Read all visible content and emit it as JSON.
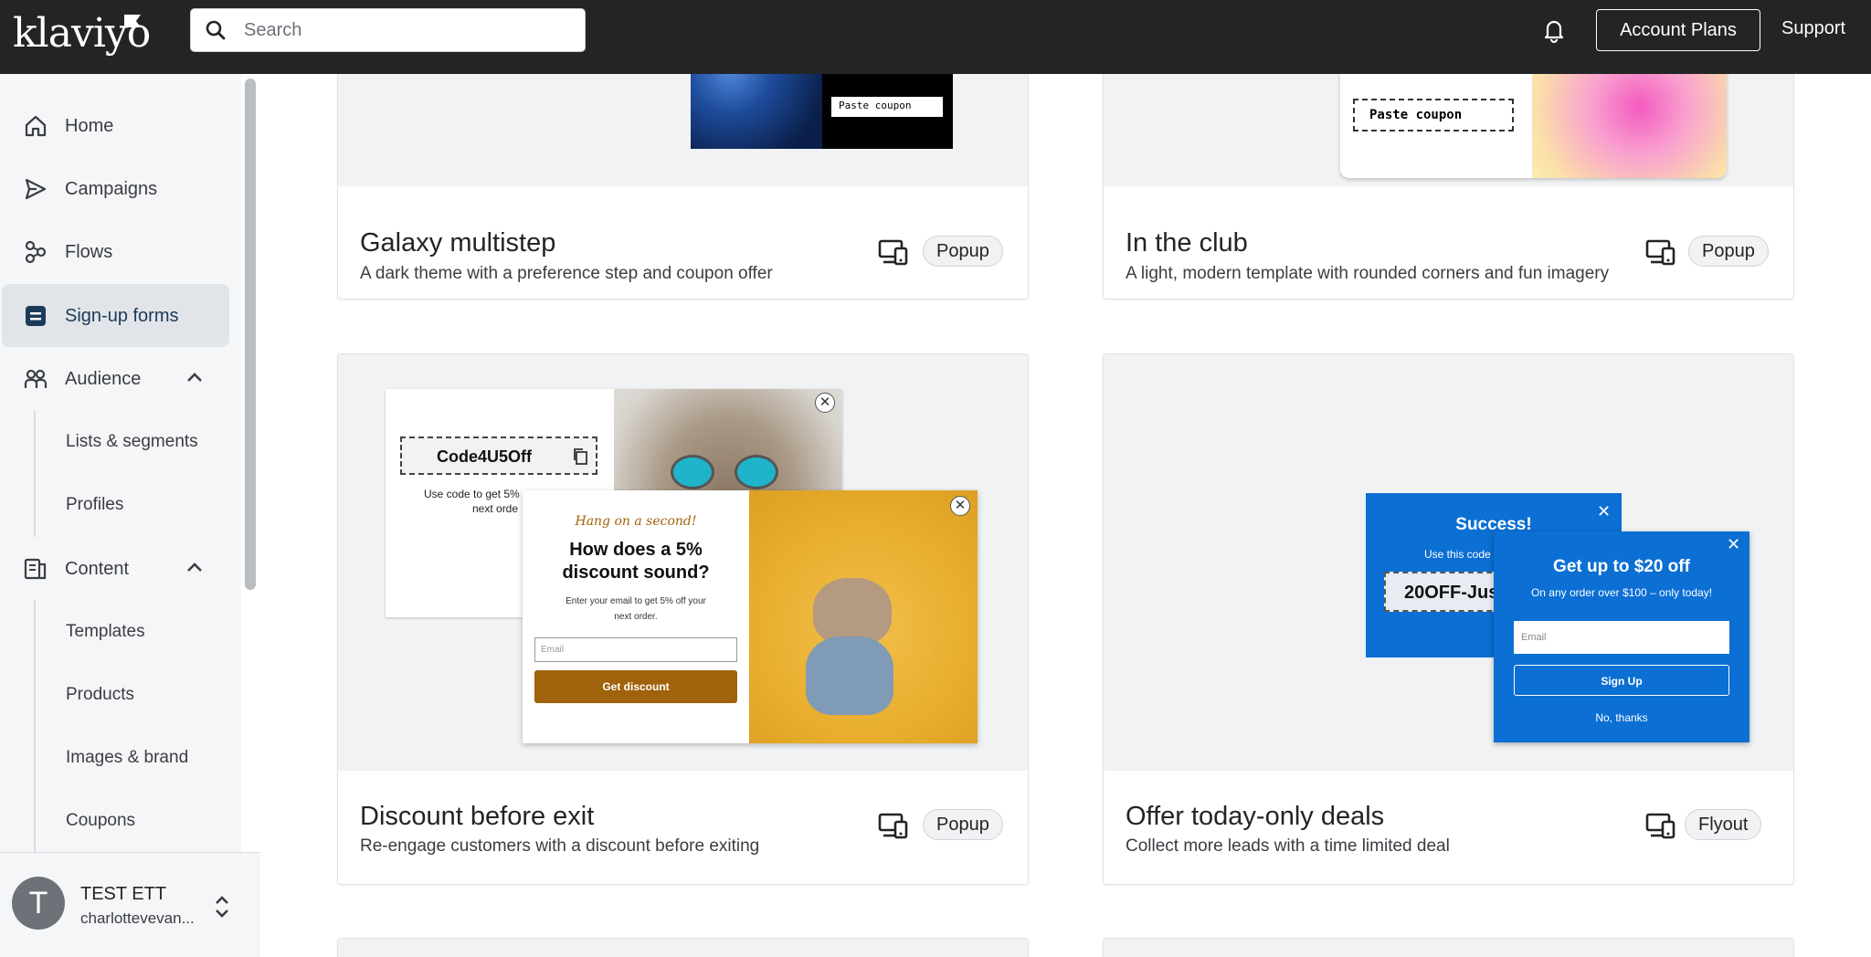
{
  "topbar": {
    "logo": "klaviyo",
    "search_placeholder": "Search",
    "account_plans_label": "Account Plans",
    "support_label": "Support"
  },
  "sidebar": {
    "items": [
      {
        "label": "Home",
        "icon": "home-icon"
      },
      {
        "label": "Campaigns",
        "icon": "send-icon"
      },
      {
        "label": "Flows",
        "icon": "flow-icon"
      },
      {
        "label": "Sign-up forms",
        "icon": "form-icon",
        "active": true
      },
      {
        "label": "Audience",
        "icon": "audience-icon",
        "expanded": true
      },
      {
        "label": "Content",
        "icon": "content-icon",
        "expanded": true
      }
    ],
    "audience_sub": [
      "Lists & segments",
      "Profiles"
    ],
    "content_sub": [
      "Templates",
      "Products",
      "Images & brand",
      "Coupons"
    ],
    "user": {
      "initial": "T",
      "name": "TEST ETT",
      "email": "charlottevevan..."
    }
  },
  "cards": [
    {
      "title": "Galaxy multistep",
      "description": "A dark theme with a preference step and coupon offer",
      "tag": "Popup",
      "preview_text": [
        "Paste coupon"
      ]
    },
    {
      "title": "In the club",
      "description": "A light, modern template with rounded corners and fun imagery",
      "tag": "Popup",
      "preview_text": [
        "Paste coupon"
      ]
    },
    {
      "title": "Discount before exit",
      "description": "Re-engage customers with a discount before exiting",
      "tag": "Popup",
      "preview": {
        "code": "Code4U5Off",
        "code_note_line1": "Use code to get 5%",
        "code_note_line2": "next orde",
        "eyebrow": "Hang on a second!",
        "headline_line1": "How does a 5%",
        "headline_line2": "discount sound?",
        "body_line1": "Enter your email to get 5% off your",
        "body_line2": "next order.",
        "email_placeholder": "Email",
        "button": "Get discount"
      }
    },
    {
      "title": "Offer today-only deals",
      "description": "Collect more leads with a time limited deal",
      "tag": "Flyout",
      "preview": {
        "success_title": "Success!",
        "success_note": "Use this code",
        "code": "20OFF-Jus",
        "headline": "Get up to $20 off",
        "subline": "On any order over $100 – only today!",
        "email_placeholder": "Email",
        "button": "Sign Up",
        "decline": "No, thanks"
      }
    }
  ],
  "colors": {
    "topbar": "#232426",
    "discount_button": "#a0620a",
    "flyout_blue": "#0b6fd3"
  }
}
